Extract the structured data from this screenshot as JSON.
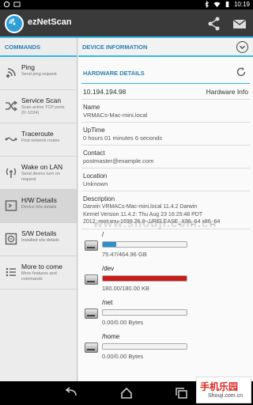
{
  "status_bar": {
    "time": "10:19"
  },
  "app": {
    "title": "ezNetScan"
  },
  "left_pane": {
    "header": "COMMANDS",
    "commands": [
      {
        "title": "Ping",
        "subtitle": "Send ping request",
        "icon": "ping-icon"
      },
      {
        "title": "Service Scan",
        "subtitle": "Scan active TCP ports (0~1024)",
        "icon": "shuffle-icon"
      },
      {
        "title": "Traceroute",
        "subtitle": "Find network routes",
        "icon": "route-icon"
      },
      {
        "title": "Wake on LAN",
        "subtitle": "Send device turn on request",
        "icon": "antenna-icon"
      },
      {
        "title": "H/W Details",
        "subtitle": "Device h/w details",
        "icon": "hardware-icon"
      },
      {
        "title": "S/W Details",
        "subtitle": "Installed s/w details",
        "icon": "disc-icon"
      },
      {
        "title": "More to come",
        "subtitle": "More features and commands",
        "icon": "list-icon"
      }
    ]
  },
  "right_pane": {
    "header": "DEVICE INFORMATION",
    "hardware_header": "HARDWARE DETAILS",
    "ip": "10.194.194.98",
    "hardware_label": "Hardware Info",
    "fields": [
      {
        "label": "Name",
        "value": "VRMACs-Mac-mini.local"
      },
      {
        "label": "UpTime",
        "value": "0 hours 01 minutes 6 seconds"
      },
      {
        "label": "Contact",
        "value": "postmaster@example.com"
      },
      {
        "label": "Location",
        "value": "Unknown"
      },
      {
        "label": "Description",
        "value_line1": "Darwin VRMACs-Mac-mini.local 11.4.2 Darwin",
        "value_line2": "Kernel Version 11.4.2: Thu Aug 23 16:25:48 PDT",
        "value_line3": "2012; root:xnu-1699.26.8~1/RELEASE_X86_64 x86_64"
      }
    ],
    "disks": [
      {
        "path": "/",
        "usage": "75.47/464.96 GB",
        "fraction": 0.162,
        "color": "#2e8fcb"
      },
      {
        "path": "/dev",
        "usage": "180.00/180.00 KB",
        "fraction": 1.0,
        "color": "#cc1b1b"
      },
      {
        "path": "/net",
        "usage": "0.00/0.00 Bytes",
        "fraction": 0.0,
        "color": "#2e8fcb"
      },
      {
        "path": "/home",
        "usage": "0.00/0.00 Bytes",
        "fraction": 0.0,
        "color": "#2e8fcb"
      }
    ]
  },
  "watermark": {
    "text": "www.shouji.com.cn",
    "brand_cn": "手机乐园",
    "brand_en": "Shouji.com.cn"
  },
  "colors": {
    "accent": "#33b5e5",
    "header_text": "#2a7fb4",
    "actionbar": "#3a3a3a"
  }
}
